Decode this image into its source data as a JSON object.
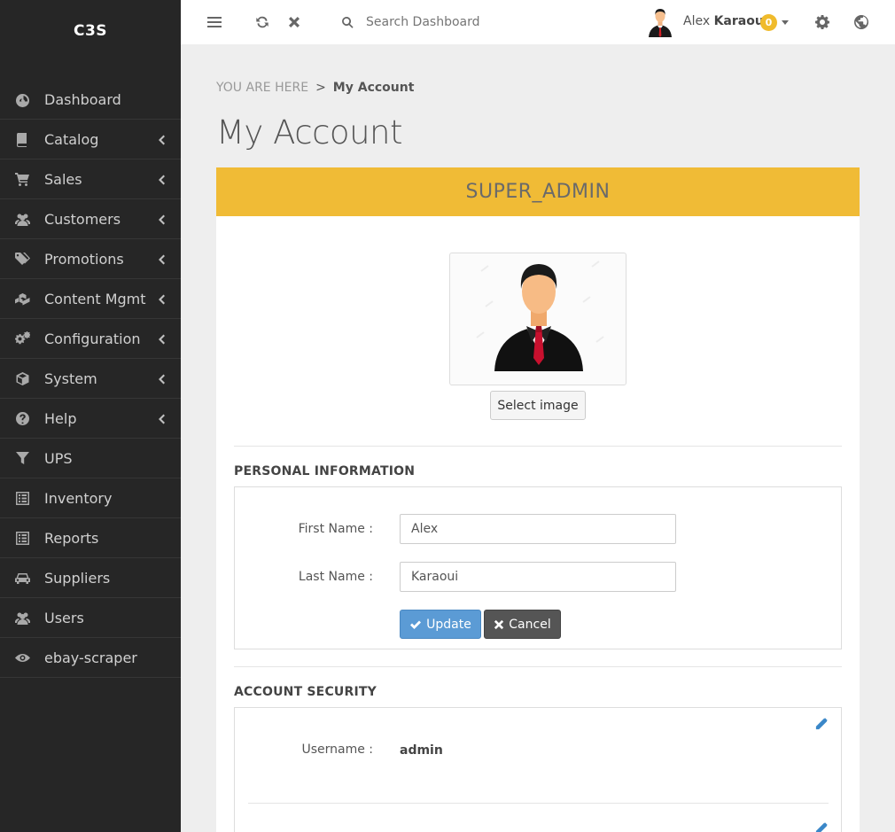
{
  "app": {
    "brand": "C3S"
  },
  "sidebar": {
    "items": [
      {
        "label": "Dashboard",
        "icon": "dashboard-icon",
        "has_submenu": false
      },
      {
        "label": "Catalog",
        "icon": "book-icon",
        "has_submenu": true
      },
      {
        "label": "Sales",
        "icon": "cart-icon",
        "has_submenu": true
      },
      {
        "label": "Customers",
        "icon": "users-icon",
        "has_submenu": true
      },
      {
        "label": "Promotions",
        "icon": "tags-icon",
        "has_submenu": true
      },
      {
        "label": "Content Mgmt",
        "icon": "cubes-icon",
        "has_submenu": true
      },
      {
        "label": "Configuration",
        "icon": "cogs-icon",
        "has_submenu": true
      },
      {
        "label": "System",
        "icon": "cube-icon",
        "has_submenu": true
      },
      {
        "label": "Help",
        "icon": "question-circle-icon",
        "has_submenu": true
      },
      {
        "label": "UPS",
        "icon": "filter-icon",
        "has_submenu": false
      },
      {
        "label": "Inventory",
        "icon": "list-alt-icon",
        "has_submenu": false
      },
      {
        "label": "Reports",
        "icon": "list-alt-icon",
        "has_submenu": false
      },
      {
        "label": "Suppliers",
        "icon": "car-icon",
        "has_submenu": false
      },
      {
        "label": "Users",
        "icon": "users-icon",
        "has_submenu": false
      },
      {
        "label": "ebay-scraper",
        "icon": "eye-icon",
        "has_submenu": false
      }
    ]
  },
  "topbar": {
    "search_placeholder": "Search Dashboard",
    "user_first": "Alex",
    "user_last": "Karaoui",
    "notification_count": "0"
  },
  "breadcrumb": {
    "prefix": "YOU ARE HERE",
    "separator": ">",
    "current": "My Account"
  },
  "page": {
    "title": "My Account",
    "role": "SUPER_ADMIN",
    "select_image_label": "Select image"
  },
  "personal": {
    "section_title": "PERSONAL INFORMATION",
    "first_name_label": "First Name :",
    "first_name_value": "Alex",
    "last_name_label": "Last Name :",
    "last_name_value": "Karaoui",
    "update_label": "Update",
    "cancel_label": "Cancel"
  },
  "security": {
    "section_title": "ACCOUNT SECURITY",
    "username_label": "Username :",
    "username_value": "admin"
  },
  "colors": {
    "sidebar_bg": "#262626",
    "role_bar": "#f0bb36",
    "update_button": "#5b9bd5",
    "cancel_button": "#555555",
    "badge": "#f0bb2c",
    "edit_icon": "#3a87c8"
  }
}
